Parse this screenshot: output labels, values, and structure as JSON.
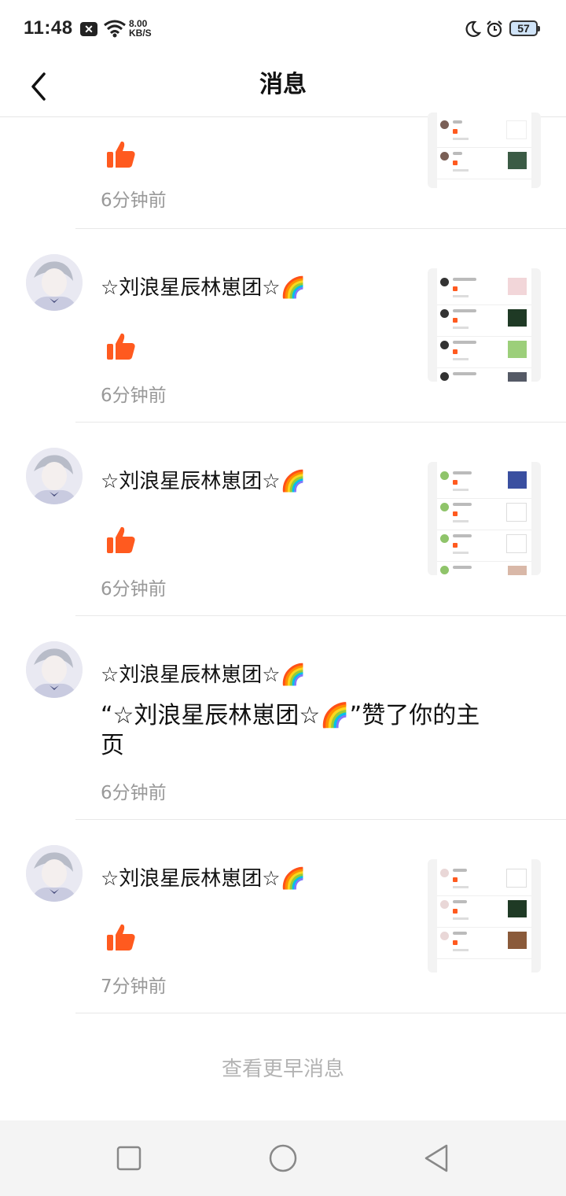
{
  "status_bar": {
    "time": "11:48",
    "notification_badge": "✕",
    "net_speed_value": "8.00",
    "net_speed_unit": "KB/S",
    "battery": "57",
    "icons": [
      "close-box-icon",
      "wifi-icon",
      "moon-icon",
      "alarm-icon",
      "battery-icon"
    ]
  },
  "header": {
    "title": "消息",
    "back_icon": "chevron-left-icon"
  },
  "messages": [
    {
      "name": "",
      "type": "like",
      "time": "6分钟前",
      "has_preview": true
    },
    {
      "name": "☆刘浪星辰林崽团☆🌈",
      "type": "like",
      "time": "6分钟前",
      "has_preview": true
    },
    {
      "name": "☆刘浪星辰林崽团☆🌈",
      "type": "like",
      "time": "6分钟前",
      "has_preview": true
    },
    {
      "name": "☆刘浪星辰林崽团☆🌈",
      "type": "text",
      "text": "“☆刘浪星辰林崽团☆🌈”赞了你的主页",
      "time": "6分钟前",
      "has_preview": false
    },
    {
      "name": "☆刘浪星辰林崽团☆🌈",
      "type": "like",
      "time": "7分钟前",
      "has_preview": true
    }
  ],
  "footer": {
    "more_label": "查看更早消息"
  },
  "system_nav": [
    "recents-square-icon",
    "home-circle-icon",
    "back-triangle-icon"
  ],
  "colors": {
    "accent_like": "#ff5a1f",
    "time_gray": "#999999",
    "more_gray": "#b3b3b3",
    "nav_bg": "#f4f4f4"
  }
}
